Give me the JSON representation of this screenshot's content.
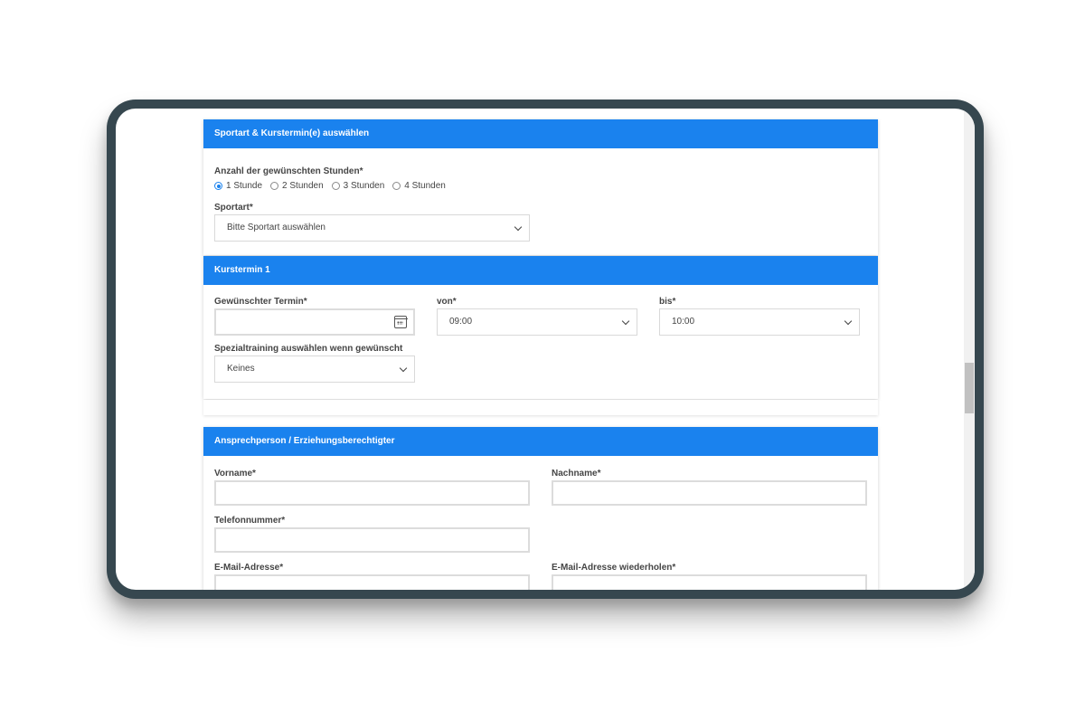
{
  "section1": {
    "header": "Sportart & Kurstermin(e) auswählen",
    "hours_label": "Anzahl der gewünschten Stunden*",
    "hours_options": [
      "1 Stunde",
      "2 Stunden",
      "3 Stunden",
      "4 Stunden"
    ],
    "hours_selected": "1 Stunde",
    "sport_label": "Sportart*",
    "sport_value": "Bitte Sportart auswählen"
  },
  "section2": {
    "header": "Kurstermin 1",
    "date_label": "Gewünschter Termin*",
    "date_value": "",
    "from_label": "von*",
    "from_value": "09:00",
    "to_label": "bis*",
    "to_value": "10:00",
    "special_label": "Spezialtraining auswählen wenn gewünscht",
    "special_value": "Keines"
  },
  "section3": {
    "header": "Ansprechperson / Erziehungsberechtigter",
    "firstname_label": "Vorname*",
    "lastname_label": "Nachname*",
    "phone_label": "Telefonnummer*",
    "email_label": "E-Mail-Adresse*",
    "email_repeat_label": "E-Mail-Adresse wiederholen*"
  },
  "colors": {
    "accent": "#1a82ee",
    "frame": "#36474f"
  }
}
